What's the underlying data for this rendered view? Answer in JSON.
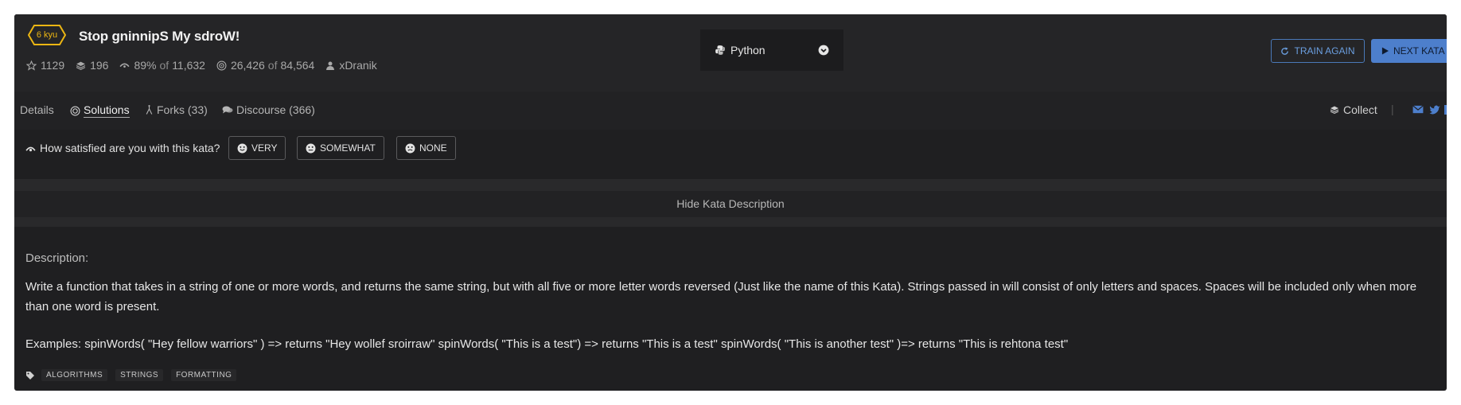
{
  "kata": {
    "rank": "6 kyu",
    "title": "Stop gninnipS My sdroW!",
    "stats": {
      "stars": "1129",
      "collections": "196",
      "satisfaction_pct": "89%",
      "of_label": "of",
      "satisfaction_votes": "11,632",
      "completed": "26,426",
      "attempted": "84,564",
      "author": "xDranik"
    }
  },
  "language_select": {
    "selected": "Python"
  },
  "actions": {
    "train_again": "TRAIN AGAIN",
    "next_kata": "NEXT KATA"
  },
  "tabs": [
    {
      "label": "Details"
    },
    {
      "label": "Solutions"
    },
    {
      "label": "Forks (33)"
    },
    {
      "label": "Discourse (366)"
    }
  ],
  "collect_label": "Collect",
  "separator": "|",
  "satisfaction": {
    "question": "How satisfied are you with this kata?",
    "options": [
      "VERY",
      "SOMEWHAT",
      "NONE"
    ]
  },
  "description_toggle": "Hide Kata Description",
  "description": {
    "heading": "Description:",
    "body": "Write a function that takes in a string of one or more words, and returns the same string, but with all five or more letter words reversed (Just like the name of this Kata). Strings passed in will consist of only letters and spaces. Spaces will be included only when more than one word is present.",
    "examples": "Examples: spinWords( \"Hey fellow warriors\" ) => returns \"Hey wollef sroirraw\" spinWords( \"This is a test\") => returns \"This is a test\" spinWords( \"This is another test\" )=> returns \"This is rehtona test\""
  },
  "tags": [
    "ALGORITHMS",
    "STRINGS",
    "FORMATTING"
  ],
  "colors": {
    "rank_yellow": "#ecb613",
    "accent_blue": "#4d7fcc",
    "panel_bg": "#1f1f21"
  },
  "icons": {
    "stars": "star-outline-icon",
    "collections": "layers-icon",
    "satisfaction": "rocket-icon",
    "completed": "target-icon",
    "author": "user-icon",
    "language": "python-icon",
    "train_again": "refresh-icon",
    "next_kata": "play-icon",
    "solutions": "bullseye-icon",
    "forks": "fork-icon",
    "discourse": "comments-icon",
    "collect": "layers-icon",
    "share": [
      "envelope-icon",
      "twitter-icon"
    ],
    "tag": "tag-icon"
  }
}
